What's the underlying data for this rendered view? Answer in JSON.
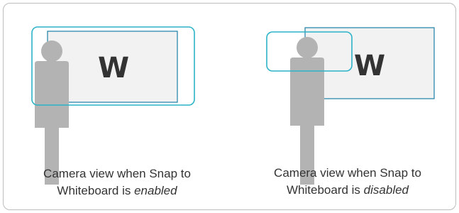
{
  "left": {
    "whiteboard_letter": "W",
    "caption_line1": "Camera view when Snap to",
    "caption_prefix": "Whiteboard is ",
    "caption_state": "enabled"
  },
  "right": {
    "whiteboard_letter": "W",
    "caption_line1": "Camera view when Snap to",
    "caption_prefix": "Whiteboard is ",
    "caption_state": "disabled"
  },
  "colors": {
    "camera_frame": "#2bb3c8",
    "whiteboard_border": "#1b7fa6",
    "whiteboard_fill": "#f2f2f2",
    "person": "#b3b3b3",
    "panel_border": "#bdbdbd"
  }
}
